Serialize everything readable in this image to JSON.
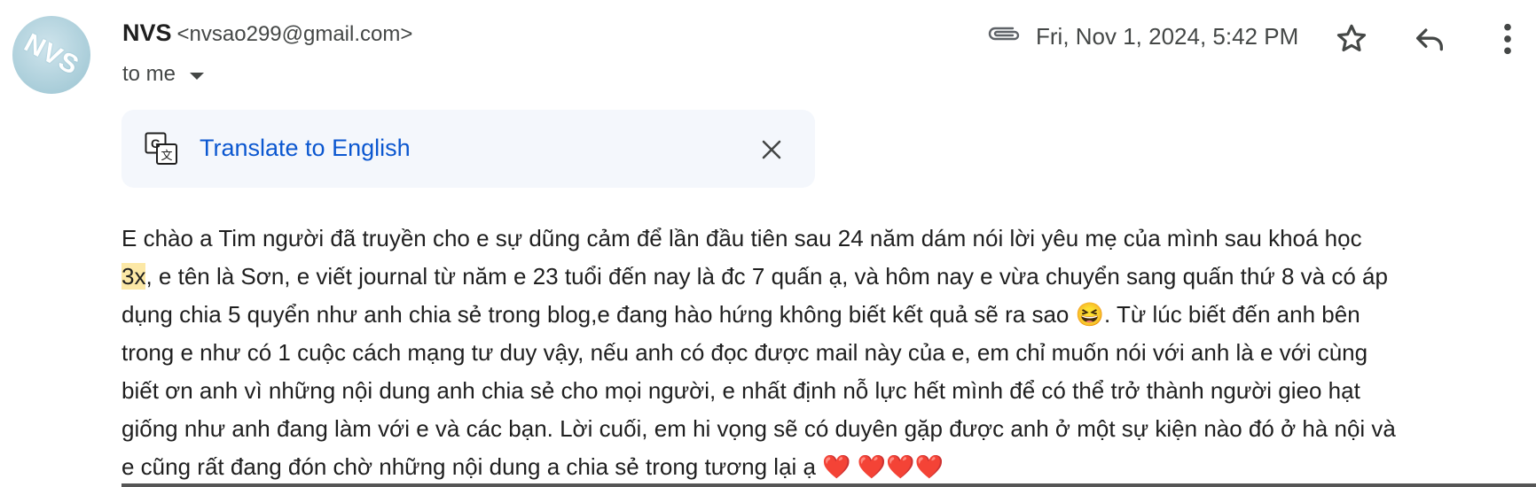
{
  "sender": {
    "avatar_text": "NVS",
    "name": "NVS",
    "email": "<nvsao299@gmail.com>",
    "recipient_label": "to me"
  },
  "header": {
    "date": "Fri, Nov 1, 2024, 5:42 PM",
    "icons": [
      "attachment-icon",
      "star-icon",
      "reply-icon",
      "more-options-icon"
    ]
  },
  "translate": {
    "label": "Translate to English",
    "icons": [
      "google-translate-icon",
      "close-icon"
    ]
  },
  "message": {
    "part1": "E chào a Tim người đã truyền cho e sự dũng cảm để lần đầu tiên sau 24 năm dám nói lời yêu mẹ của mình sau khoá học\n",
    "highlight": "3x",
    "part2": ", e tên là Sơn, e viết journal từ năm e 23 tuổi đến nay là đc 7 quấn ạ, và hôm nay e vừa chuyển sang quấn thứ 8 và có áp\ndụng chia 5 quyển như anh chia sẻ trong blog,e đang hào hứng không biết kết quả sẽ ra sao 😆. Từ lúc biết đến anh bên\ntrong e như  có 1 cuộc cách mạng tư duy vậy, nếu anh có đọc được mail này của e, em chỉ muốn nói với anh là e với cùng\nbiết ơn anh vì những nội dung anh chia sẻ cho mọi người, e nhất định nỗ lực hết mình để có thể trở thành người gieo hạt\ngiống như anh đang làm với e và các bạn. Lời cuối, em hi vọng sẽ có duyên gặp được anh ở một sự kiện nào đó ở hà nội và\ne cũng rất đang đón chờ những nội dung a chia sẻ trong tương lại ạ ❤️ ❤️❤️❤️"
  }
}
